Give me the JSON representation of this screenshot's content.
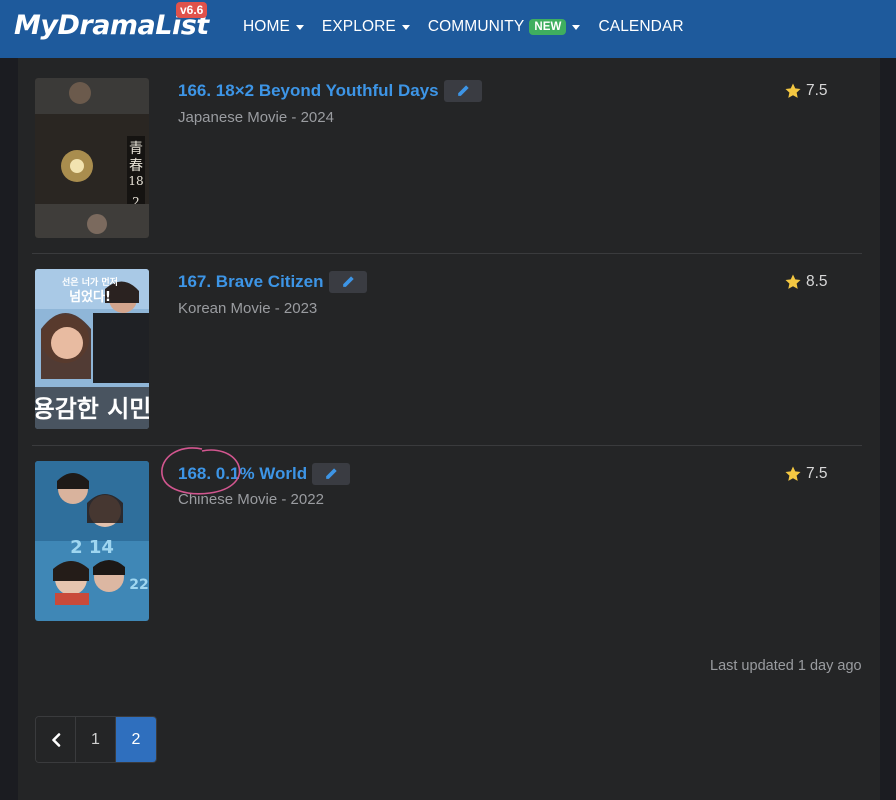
{
  "header": {
    "logo": "MyDramaList",
    "version": "v6.6",
    "nav": [
      {
        "label": "HOME"
      },
      {
        "label": "EXPLORE"
      },
      {
        "label": "COMMUNITY",
        "badge": "NEW"
      },
      {
        "label": "CALENDAR"
      }
    ],
    "colors": {
      "bar": "#1e5a9c",
      "badge_new": "#3fae5f",
      "badge_version": "#e0524b"
    }
  },
  "list": {
    "items": [
      {
        "title": "166. 18×2 Beyond Youthful Days",
        "subtitle": "Japanese Movie - 2024",
        "rating": "7.5"
      },
      {
        "title": "167. Brave Citizen",
        "subtitle": "Korean Movie - 2023",
        "rating": "8.5"
      },
      {
        "title": "168. 0.1% World",
        "subtitle": "Chinese Movie - 2022",
        "rating": "7.5"
      }
    ]
  },
  "footer": {
    "last_updated": "Last updated 1 day ago"
  },
  "pagination": {
    "pages": [
      "1",
      "2"
    ],
    "active": "2"
  },
  "icons": {
    "edit": "pencil-icon",
    "rating": "star-icon",
    "prev": "chevron-left-icon"
  }
}
